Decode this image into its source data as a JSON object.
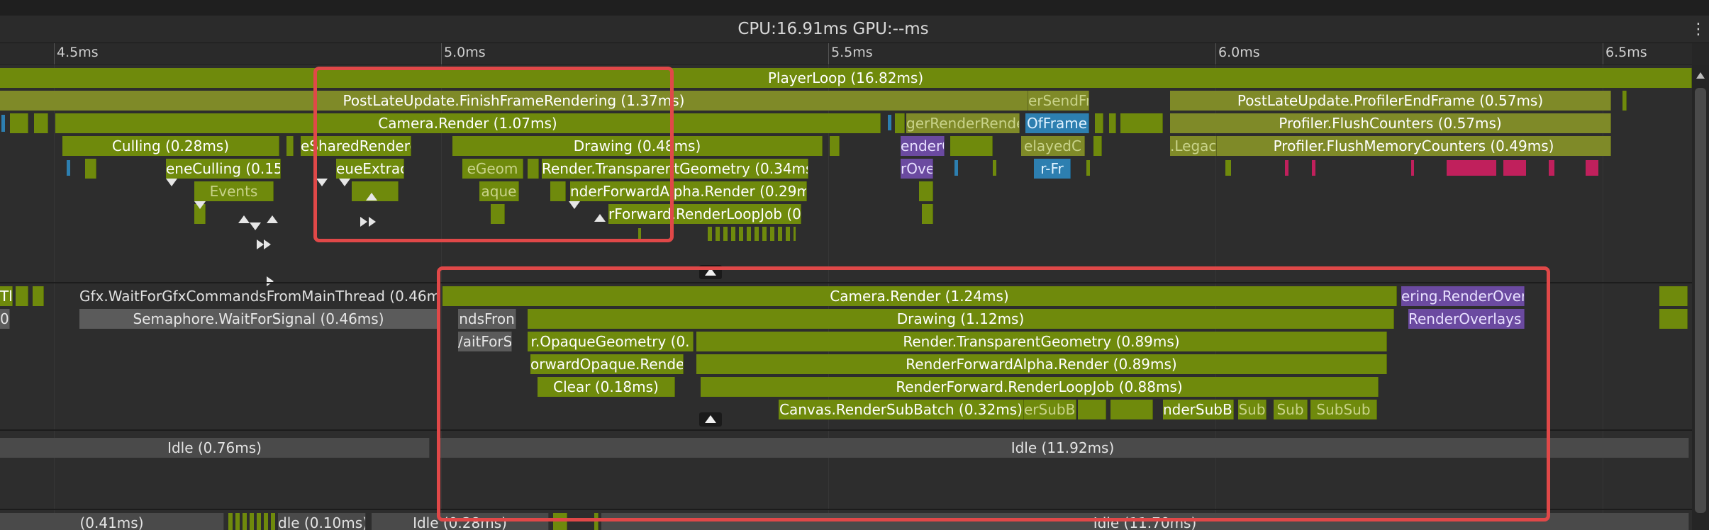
{
  "header": {
    "stats": "CPU:16.91ms   GPU:--ms"
  },
  "ruler": {
    "ticks": [
      "4.5ms",
      "5.0ms",
      "5.5ms",
      "6.0ms",
      "6.5ms"
    ]
  },
  "main_thread": {
    "player_loop": "PlayerLoop (16.82ms)",
    "finish_frame": "PostLateUpdate.FinishFrameRendering (1.37ms)",
    "send_frame": "erSendFra",
    "profiler_end_frame": "PostLateUpdate.ProfilerEndFrame (0.57ms)",
    "camera_render": "Camera.Render (1.07ms)",
    "render_overlays_clip": "gerRenderRende",
    "of_frame": "OfFrame",
    "flush_counters": "Profiler.FlushCounters (0.57ms)",
    "culling": "Culling (0.28ms)",
    "shared_renderer": "eSharedRendere",
    "drawing": "Drawing (0.48ms)",
    "render_clip": "enderC",
    "delayed": "elayedC",
    "legacy": ".Legacy",
    "flush_memory": "Profiler.FlushMemoryCounters (0.49ms)",
    "scene_culling": "eneCulling (0.15m",
    "queue_extract": "eueExtrac",
    "geom_clip": "eGeom",
    "transparent": "Render.TransparentGeometry (0.34ms)",
    "rover_clip": "rOve",
    "fr_clip": "r-Fr",
    "events": "Events",
    "opaque_clip": "aque",
    "forward_alpha": "nderForwardAlpha.Render (0.29m",
    "loop_job": "rForward.RenderLoopJob (0."
  },
  "render_thread": {
    "wait_main": "Gfx.WaitForGfxCommandsFromMainThread (0.46ms)",
    "t_clip": "Tl",
    "camera_render": "Camera.Render (1.24ms)",
    "render_overlays": "ering.RenderOverla",
    "semaphore": "Semaphore.WaitForSignal (0.46ms)",
    "zero_clip": "0.",
    "cmds_clip": "ndsFron",
    "drawing": "Drawing (1.12ms)",
    "render_overlays2": "RenderOverlays (",
    "wait_clip": "/aitForSi",
    "opaque": "r.OpaqueGeometry (0.",
    "transparent": "Render.TransparentGeometry (0.89ms)",
    "forward_opaque": "orwardOpaque.Render",
    "forward_alpha": "RenderForwardAlpha.Render (0.89ms)",
    "clear": "Clear (0.18ms)",
    "loop_job": "RenderForward.RenderLoopJob (0.88ms)",
    "subbatch": "Canvas.RenderSubBatch (0.32ms)",
    "subbatch_clip1": "erSubBa",
    "subbatch_clip2": "nderSubBat",
    "sub1": "Sub",
    "sub2": "Sub",
    "sub3": "SubSub"
  },
  "worker1": {
    "idle1": "Idle (0.76ms)",
    "idle2": "Idle (11.92ms)"
  },
  "worker2": {
    "idle1": "(0.41ms)",
    "idle2": "dle (0.10ms)",
    "idle3": "Idle (0.28ms)",
    "idle4": "Idle (11.70ms)"
  },
  "colors": {
    "highlight": "#e04848",
    "main_green": "#6f8a0c",
    "faded_green": "#7f8a28",
    "idle_grey": "#4a4a4a",
    "overlay_purple": "#6b4aa0",
    "blue": "#2d7fb0"
  }
}
